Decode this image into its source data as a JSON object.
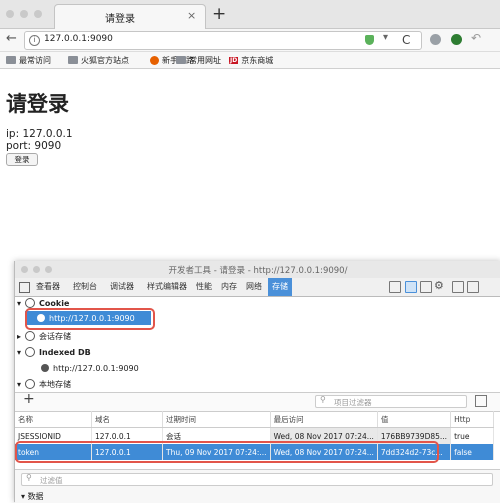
{
  "browser": {
    "tab_title": "请登录",
    "tab_close": "×",
    "new_tab": "+",
    "back": "←",
    "url": "127.0.0.1:9090",
    "info": "i",
    "reload": "C",
    "dropdown": "▾",
    "bookmarks": [
      {
        "label": "最常访问",
        "icon": "folder-icon"
      },
      {
        "label": "火狐官方站点",
        "icon": "folder-icon"
      },
      {
        "label": "新手上路",
        "icon": "firefox-icon"
      },
      {
        "label": "常用网址",
        "icon": "folder-icon"
      },
      {
        "label": "京东商城",
        "icon": "jd-icon"
      }
    ],
    "jd_glyph": "JD"
  },
  "page": {
    "title": "请登录",
    "ip": "ip: 127.0.0.1",
    "port": "port: 9090",
    "login_button": "登录"
  },
  "devtools": {
    "title": "开发者工具 - 请登录 - http://127.0.0.1:9090/",
    "tabs": [
      "查看器",
      "控制台",
      "调试器",
      "样式编辑器",
      "性能",
      "内存",
      "网络",
      "存储"
    ],
    "selected_tab": "存储",
    "tree": {
      "cookie_label": "Cookie",
      "cookie_host": "http://127.0.0.1:9090",
      "session_label": "会话存储",
      "indexeddb_label": "Indexed DB",
      "indexeddb_host": "http://127.0.0.1:9090",
      "local_label": "本地存储",
      "expander_open": "▾",
      "expander_closed": "▸"
    },
    "add_button": "+",
    "filter_placeholder": "项目过滤器",
    "columns": [
      "名称",
      "域名",
      "过期时间",
      "最后访问",
      "值",
      "Http"
    ],
    "rows": [
      [
        "JSESSIONID",
        "127.0.0.1",
        "会话",
        "Wed, 08 Nov 2017 07:24...",
        "176BB9739D85...",
        "true"
      ],
      [
        "token",
        "127.0.0.1",
        "Thu, 09 Nov 2017 07:24:...",
        "Wed, 08 Nov 2017 07:24...",
        "7dd324d2-73c...",
        "false"
      ]
    ],
    "bottom_filter_placeholder": "过滤值",
    "data_section": "数据"
  },
  "colors": {
    "accent": "#3f8bd6",
    "highlight_box": "#e2554a"
  }
}
